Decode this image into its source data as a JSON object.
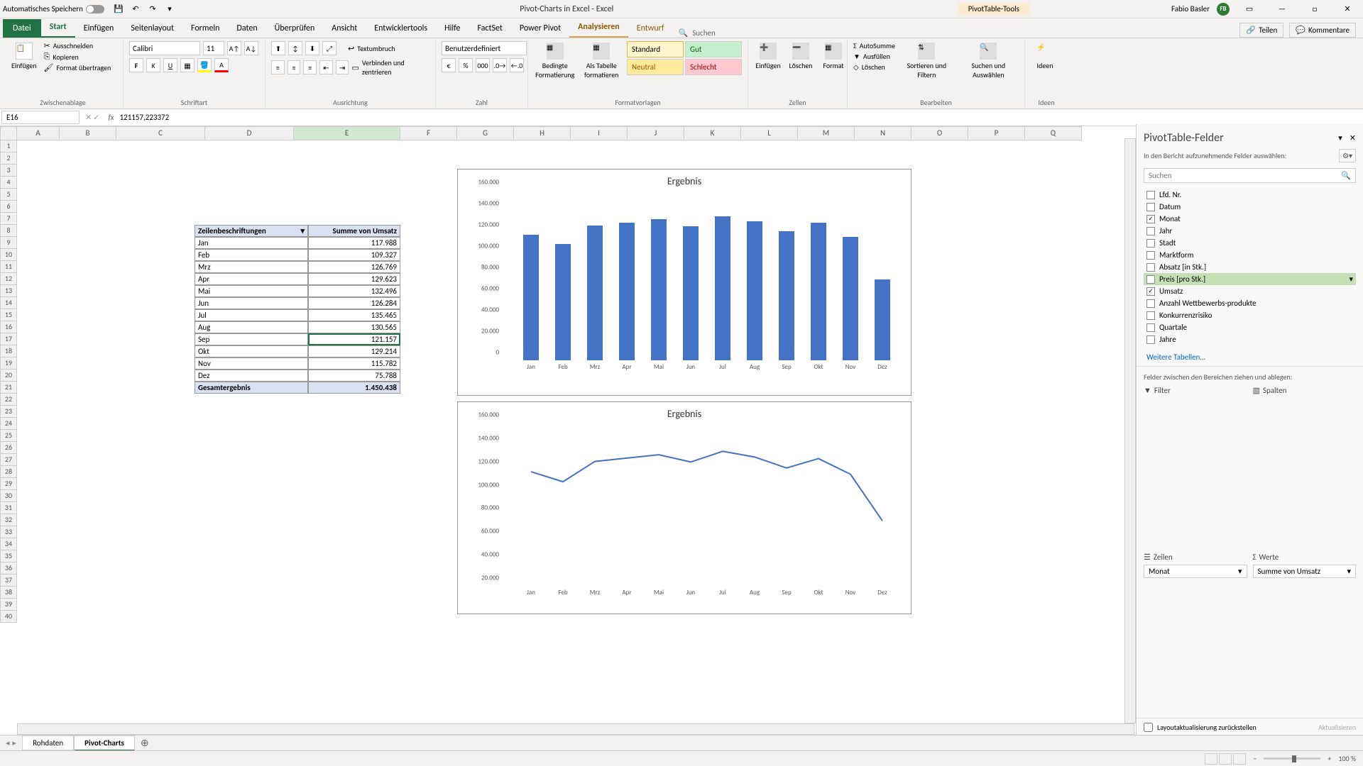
{
  "titlebar": {
    "autosave_label": "Automatisches Speichern",
    "doc_title": "Pivot-Charts in Excel  -  Excel",
    "context_tab": "PivotTable-Tools",
    "user_name": "Fabio Basler",
    "user_initials": "FB"
  },
  "ribbon_tabs": {
    "file": "Datei",
    "tabs": [
      "Start",
      "Einfügen",
      "Seitenlayout",
      "Formeln",
      "Daten",
      "Überprüfen",
      "Ansicht",
      "Entwicklertools",
      "Hilfe",
      "FactSet",
      "Power Pivot"
    ],
    "ctx_tabs": [
      "Analysieren",
      "Entwurf"
    ],
    "search_placeholder": "Suchen",
    "share": "Teilen",
    "comments": "Kommentare"
  },
  "ribbon": {
    "clipboard": {
      "paste": "Einfügen",
      "cut": "Ausschneiden",
      "copy": "Kopieren",
      "format_painter": "Format übertragen",
      "label": "Zwischenablage"
    },
    "font": {
      "name": "Calibri",
      "size": "11",
      "label": "Schriftart"
    },
    "alignment": {
      "wrap": "Textumbruch",
      "merge": "Verbinden und zentrieren",
      "label": "Ausrichtung"
    },
    "number": {
      "format": "Benutzerdefiniert",
      "label": "Zahl"
    },
    "styles": {
      "cond": "Bedingte Formatierung",
      "as_table": "Als Tabelle formatieren",
      "s1": "Standard",
      "s2": "Gut",
      "s3": "Neutral",
      "s4": "Schlecht",
      "label": "Formatvorlagen"
    },
    "cells": {
      "insert": "Einfügen",
      "delete": "Löschen",
      "format": "Format",
      "label": "Zellen"
    },
    "editing": {
      "autosum": "AutoSumme",
      "fill": "Ausfüllen",
      "clear": "Löschen",
      "sort": "Sortieren und Filtern",
      "find": "Suchen und Auswählen",
      "label": "Bearbeiten"
    },
    "ideas": {
      "btn": "Ideen",
      "label": "Ideen"
    }
  },
  "namebox": "E16",
  "formula": "121157,223372",
  "columns": [
    "A",
    "B",
    "C",
    "D",
    "E",
    "F",
    "G",
    "H",
    "I",
    "J",
    "K",
    "L",
    "M",
    "N",
    "O",
    "P",
    "Q"
  ],
  "pivot_table": {
    "hdr_rows": "Zeilenbeschriftungen",
    "hdr_vals": "Summe von Umsatz",
    "rows": [
      {
        "label": "Jan",
        "val": "117.988"
      },
      {
        "label": "Feb",
        "val": "109.327"
      },
      {
        "label": "Mrz",
        "val": "126.769"
      },
      {
        "label": "Apr",
        "val": "129.623"
      },
      {
        "label": "Mai",
        "val": "132.496"
      },
      {
        "label": "Jun",
        "val": "126.284"
      },
      {
        "label": "Jul",
        "val": "135.465"
      },
      {
        "label": "Aug",
        "val": "130.565"
      },
      {
        "label": "Sep",
        "val": "121.157"
      },
      {
        "label": "Okt",
        "val": "129.214"
      },
      {
        "label": "Nov",
        "val": "115.782"
      },
      {
        "label": "Dez",
        "val": "75.788"
      }
    ],
    "total_label": "Gesamtergebnis",
    "total_val": "1.450.438"
  },
  "chart_data": [
    {
      "type": "bar",
      "title": "Ergebnis",
      "categories": [
        "Jan",
        "Feb",
        "Mrz",
        "Apr",
        "Mai",
        "Jun",
        "Jul",
        "Aug",
        "Sep",
        "Okt",
        "Nov",
        "Dez"
      ],
      "values": [
        117988,
        109327,
        126769,
        129623,
        132496,
        126284,
        135465,
        130565,
        121157,
        129214,
        115782,
        75788
      ],
      "ylim": [
        0,
        160000
      ],
      "yticks": [
        "0",
        "20.000",
        "40.000",
        "60.000",
        "80.000",
        "100.000",
        "120.000",
        "140.000",
        "160.000"
      ]
    },
    {
      "type": "line",
      "title": "Ergebnis",
      "categories": [
        "Jan",
        "Feb",
        "Mrz",
        "Apr",
        "Mai",
        "Jun",
        "Jul",
        "Aug",
        "Sep",
        "Okt",
        "Nov",
        "Dez"
      ],
      "values": [
        117988,
        109327,
        126769,
        129623,
        132496,
        126284,
        135465,
        130565,
        121157,
        129214,
        115782,
        75788
      ],
      "ylim": [
        20000,
        160000
      ],
      "yticks": [
        "20.000",
        "40.000",
        "60.000",
        "80.000",
        "100.000",
        "120.000",
        "140.000",
        "160.000"
      ]
    }
  ],
  "pane": {
    "title": "PivotTable-Felder",
    "subtitle": "In den Bericht aufzunehmende Felder auswählen:",
    "search_placeholder": "Suchen",
    "fields": [
      {
        "name": "Lfd. Nr.",
        "checked": false
      },
      {
        "name": "Datum",
        "checked": false
      },
      {
        "name": "Monat",
        "checked": true
      },
      {
        "name": "Jahr",
        "checked": false
      },
      {
        "name": "Stadt",
        "checked": false
      },
      {
        "name": "Marktform",
        "checked": false
      },
      {
        "name": "Absatz [in Stk.]",
        "checked": false
      },
      {
        "name": "Preis [pro Stk.]",
        "checked": false,
        "hover": true
      },
      {
        "name": "Umsatz",
        "checked": true
      },
      {
        "name": "Anzahl Wettbewerbs-produkte",
        "checked": false
      },
      {
        "name": "Konkurrenzrisiko",
        "checked": false
      },
      {
        "name": "Quartale",
        "checked": false
      },
      {
        "name": "Jahre",
        "checked": false
      }
    ],
    "more_tables": "Weitere Tabellen…",
    "drop_header": "Felder zwischen den Bereichen ziehen und ablegen:",
    "filters": "Filter",
    "cols": "Spalten",
    "rows": "Zeilen",
    "vals": "Werte",
    "row_item": "Monat",
    "val_item": "Summe von Umsatz",
    "defer": "Layoutaktualisierung zurückstellen",
    "update": "Aktualisieren"
  },
  "sheets": {
    "s1": "Rohdaten",
    "s2": "Pivot-Charts"
  },
  "status": {
    "zoom": "100 %"
  }
}
